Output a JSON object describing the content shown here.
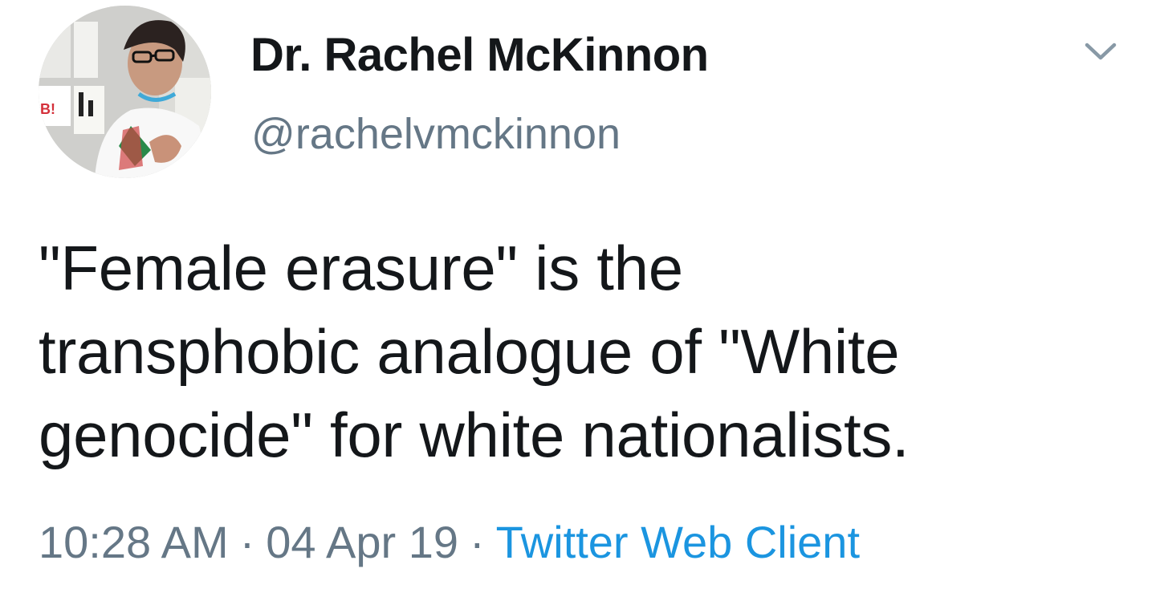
{
  "author": {
    "display_name": "Dr. Rachel McKinnon",
    "handle": "@rachelvmckinnon",
    "avatar_icon": "profile-photo"
  },
  "tweet": {
    "text_lines": [
      "\"Female erasure\" is the",
      "transphobic analogue of \"White",
      "genocide\" for white nationalists."
    ]
  },
  "meta": {
    "time": "10:28 AM",
    "separator": "·",
    "date": "04 Apr 19",
    "source": "Twitter Web Client"
  },
  "colors": {
    "text": "#14171a",
    "secondary": "#657786",
    "link": "#1b95e0",
    "caret": "#8899a6"
  },
  "icons": {
    "caret": "chevron-down-icon"
  }
}
